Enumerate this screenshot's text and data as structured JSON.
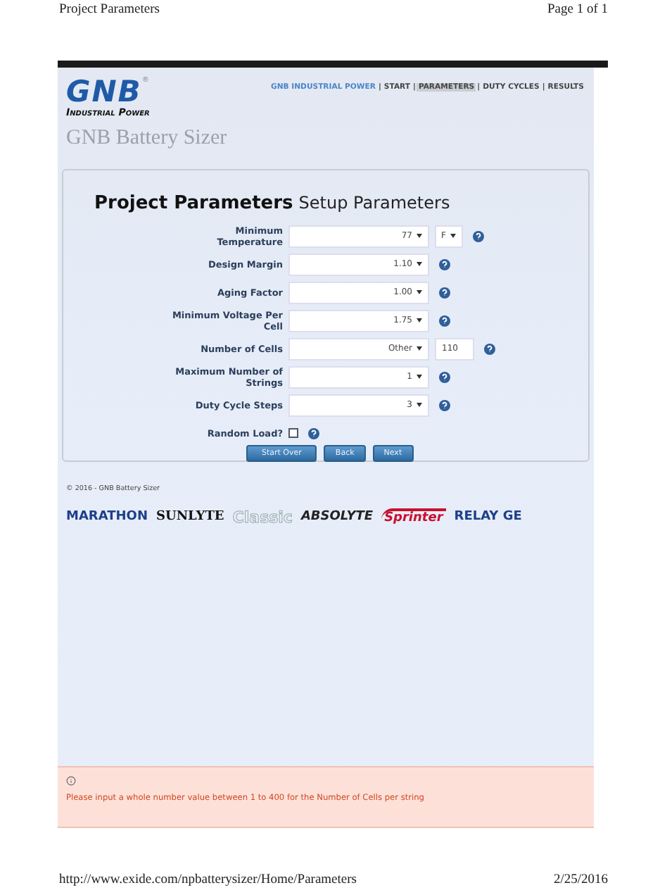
{
  "print_header": {
    "title": "Project Parameters",
    "page": "Page 1 of 1"
  },
  "logo": {
    "mark": "GNB",
    "registered": "®",
    "tagline": "Industrial Power"
  },
  "site_title": "GNB Battery Sizer",
  "nav": {
    "separator": "|",
    "items": [
      {
        "label": "GNB INDUSTRIAL POWER",
        "selected": false
      },
      {
        "label": "START",
        "selected": false
      },
      {
        "label": "PARAMETERS",
        "selected": true
      },
      {
        "label": "DUTY CYCLES",
        "selected": false
      },
      {
        "label": "RESULTS",
        "selected": false
      }
    ]
  },
  "panel": {
    "title": "Project Parameters",
    "subtitle": "Setup Parameters",
    "rows": [
      {
        "label": "Minimum Temperature",
        "kind": "select",
        "value": "77",
        "extra": {
          "kind": "select",
          "value": "F"
        }
      },
      {
        "label": "Design Margin",
        "kind": "select",
        "value": "1.10"
      },
      {
        "label": "Aging Factor",
        "kind": "select",
        "value": "1.00"
      },
      {
        "label": "Minimum Voltage Per Cell",
        "kind": "select",
        "value": "1.75"
      },
      {
        "label": "Number of Cells",
        "kind": "select",
        "value": "Other",
        "extra": {
          "kind": "input",
          "value": "110"
        }
      },
      {
        "label": "Maximum Number of Strings",
        "kind": "select",
        "value": "1"
      },
      {
        "label": "Duty Cycle Steps",
        "kind": "select",
        "value": "3"
      },
      {
        "label": "Random Load?",
        "kind": "checkbox",
        "checked": false
      }
    ],
    "buttons": [
      "Start Over",
      "Back",
      "Next"
    ]
  },
  "copyright": "© 2016 - GNB Battery Sizer",
  "brands": [
    {
      "name": "MARATHON",
      "kind": "heavy"
    },
    {
      "name": "SUNLYTE",
      "kind": "serif"
    },
    {
      "name": "Classic",
      "kind": "outline"
    },
    {
      "name": "ABSOLYTE",
      "kind": "italic"
    },
    {
      "name": "Sprinter",
      "kind": "swoosh"
    },
    {
      "name": "RELAY GE",
      "kind": "heavy"
    }
  ],
  "error": {
    "message": "Please input a whole number value between 1 to 400 for the Number of Cells per string"
  },
  "print_footer": {
    "url": "http://www.exide.com/npbatterysizer/Home/Parameters",
    "date": "2/25/2016"
  }
}
